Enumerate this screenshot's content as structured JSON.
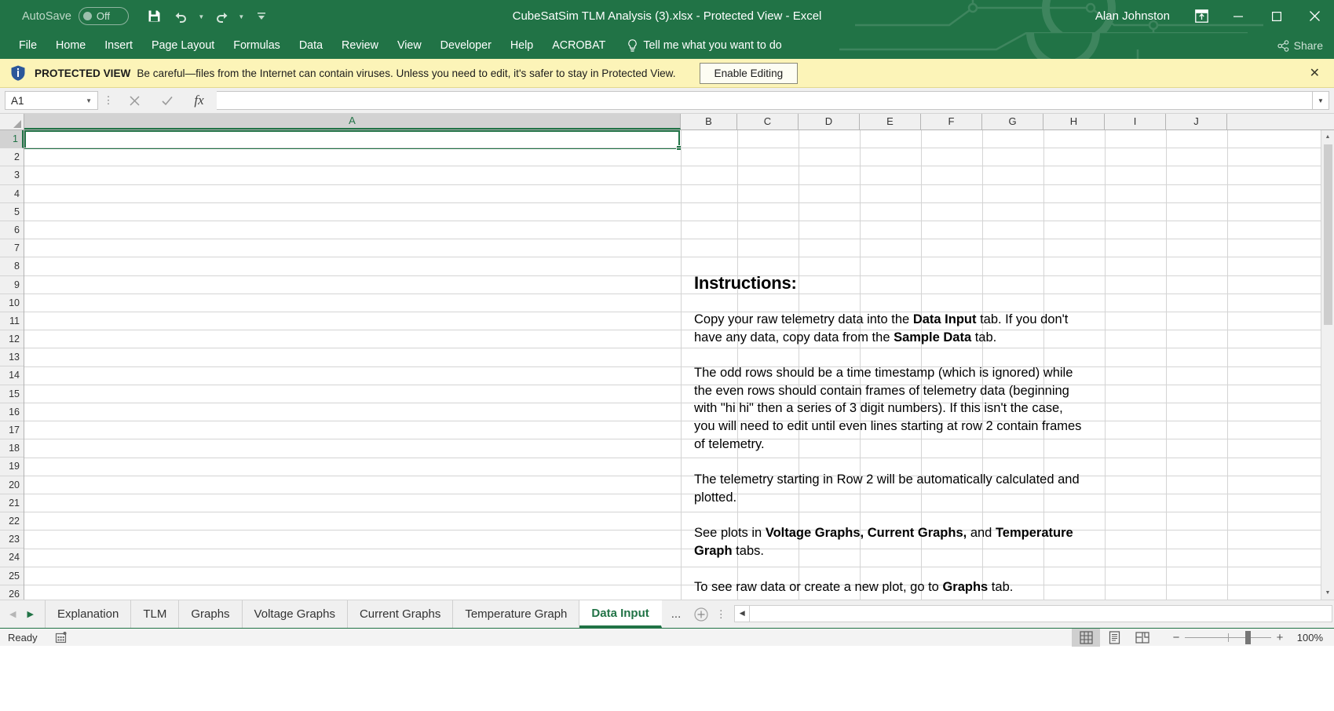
{
  "titlebar": {
    "autosave_label": "AutoSave",
    "autosave_state": "Off",
    "title": "CubeSatSim TLM Analysis (3).xlsx  -  Protected View  -  Excel",
    "user_name": "Alan Johnston",
    "icons": {
      "save": "save-icon",
      "undo": "undo-icon",
      "redo": "redo-icon",
      "customize": "customize-quick-access-icon",
      "ribbon_display": "ribbon-display-options-icon",
      "minimize": "minimize-icon",
      "maximize": "maximize-icon",
      "close": "close-icon"
    }
  },
  "ribbon": {
    "tabs": [
      "File",
      "Home",
      "Insert",
      "Page Layout",
      "Formulas",
      "Data",
      "Review",
      "View",
      "Developer",
      "Help",
      "ACROBAT"
    ],
    "tellme": "Tell me what you want to do",
    "share": "Share"
  },
  "protected_view": {
    "label": "PROTECTED VIEW",
    "message": "Be careful—files from the Internet can contain viruses. Unless you need to edit, it's safer to stay in Protected View.",
    "button": "Enable Editing",
    "close": "✕"
  },
  "formula_bar": {
    "name_box": "A1",
    "formula_value": "",
    "icons": {
      "cancel": "cancel-icon",
      "enter": "enter-icon",
      "insert_function": "insert-function-icon",
      "expand": "expand-formula-bar-icon"
    }
  },
  "grid": {
    "columns": [
      "A",
      "B",
      "C",
      "D",
      "E",
      "F",
      "G",
      "H",
      "I",
      "J"
    ],
    "selected_column": "A",
    "rows": [
      1,
      2,
      3,
      4,
      5,
      6,
      7,
      8,
      9,
      10,
      11,
      12,
      13,
      14,
      15,
      16,
      17,
      18,
      19,
      20,
      21,
      22,
      23,
      24,
      25,
      26
    ],
    "selected_row": 1,
    "active_cell": "A1"
  },
  "instructions": {
    "title": "Instructions:",
    "paragraphs": [
      [
        {
          "t": "Copy your raw telemetry data into the ",
          "b": false
        },
        {
          "t": "Data Input",
          "b": true
        },
        {
          "t": " tab.  If you don't have any data, copy data from the ",
          "b": false
        },
        {
          "t": "Sample Data",
          "b": true
        },
        {
          "t": " tab.",
          "b": false
        }
      ],
      [
        {
          "t": "The odd rows should be a time timestamp (which is ignored) while the even rows should contain frames of telemetry data (beginning with \"hi hi\" then a series of 3 digit numbers).  If this isn't the case, you will need to edit until even lines starting at row 2 contain frames of telemetry.",
          "b": false
        }
      ],
      [
        {
          "t": "The telemetry starting in Row 2 will be automatically calculated and plotted.",
          "b": false
        }
      ],
      [
        {
          "t": "See plots in ",
          "b": false
        },
        {
          "t": "Voltage Graphs, Current Graphs,",
          "b": true
        },
        {
          "t": " and ",
          "b": false
        },
        {
          "t": "Temperature Graph",
          "b": true
        },
        {
          "t": " tabs.",
          "b": false
        }
      ],
      [
        {
          "t": "To see raw data or create a new plot, go to ",
          "b": false
        },
        {
          "t": "Graphs",
          "b": true
        },
        {
          "t": " tab.",
          "b": false
        }
      ]
    ]
  },
  "sheet_tabs": {
    "tabs": [
      "Explanation",
      "TLM",
      "Graphs",
      "Voltage Graphs",
      "Current Graphs",
      "Temperature Graph",
      "Data Input"
    ],
    "active": "Data Input",
    "overflow": "...",
    "add_label": "+"
  },
  "statusbar": {
    "status": "Ready",
    "accessibility_icon": "accessibility-checker-icon",
    "views": [
      "normal-view-icon",
      "page-layout-view-icon",
      "page-break-preview-icon"
    ],
    "active_view": "normal-view-icon",
    "zoom_out": "−",
    "zoom_in": "+",
    "zoom_level": "100%"
  },
  "colors": {
    "brand_green": "#217346",
    "warning_bg": "#fcf4b8",
    "grid_line": "#d4d4d4"
  }
}
